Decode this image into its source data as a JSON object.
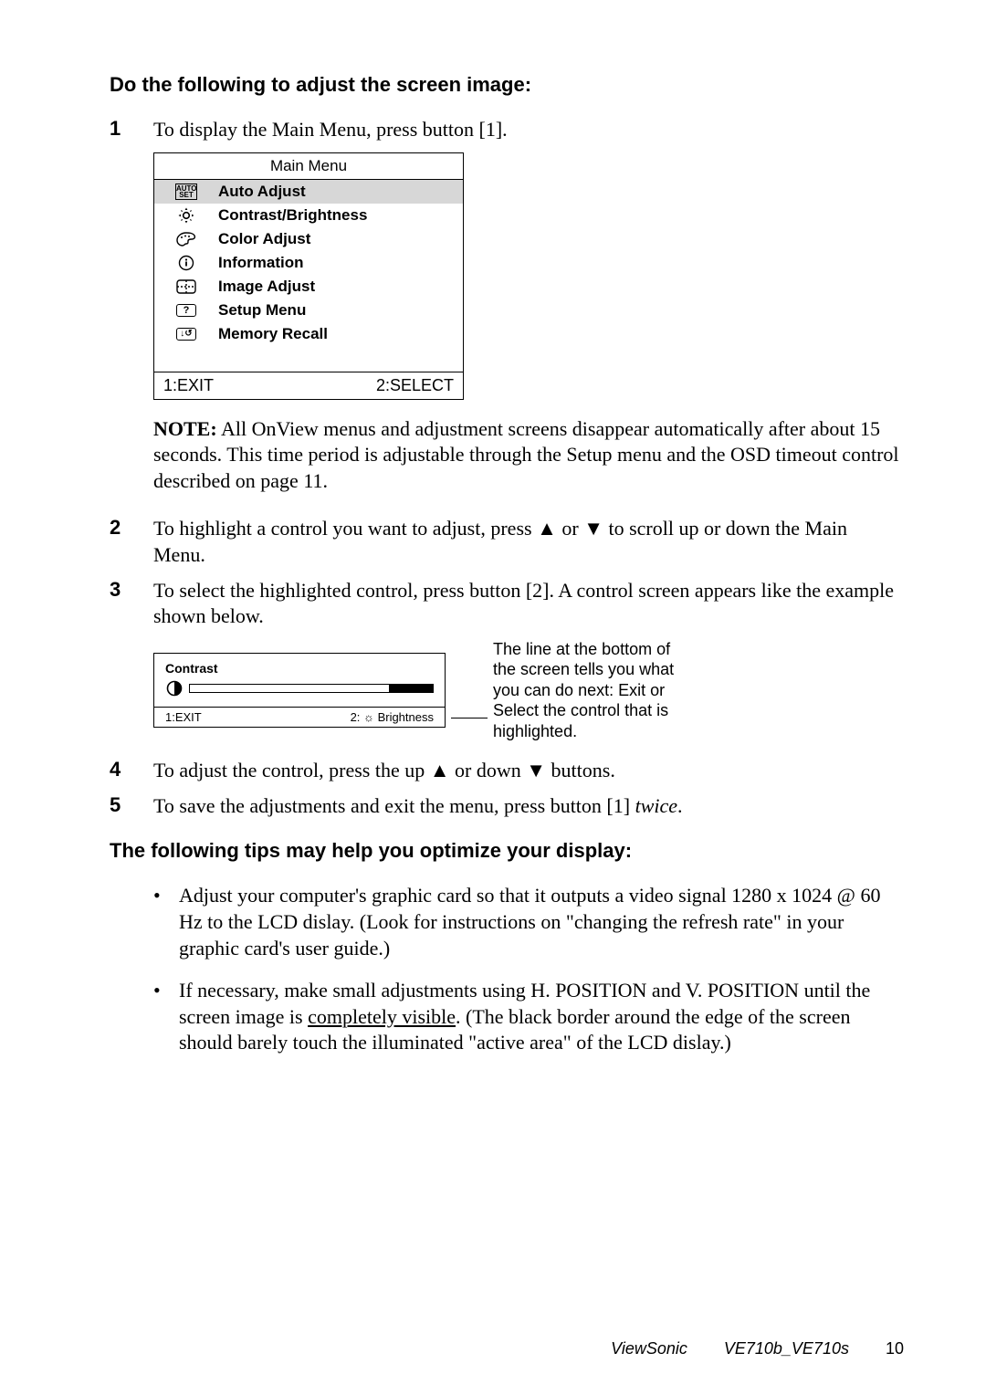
{
  "heading1": "Do the following to adjust the screen image:",
  "steps": {
    "s1": {
      "num": "1",
      "text": "To display the Main Menu, press button [1]."
    },
    "s2": {
      "num": "2",
      "text_a": "To highlight a control you want to adjust, press ",
      "up": "▲",
      "mid1": " or ",
      "down": "▼",
      "text_b": " to scroll up or down the Main Menu."
    },
    "s3": {
      "num": "3",
      "text": "To select the highlighted control, press button [2]. A control screen appears like the example shown below."
    },
    "s4": {
      "num": "4",
      "text_a": "To adjust the control, press the up ",
      "up": "▲",
      "mid1": " or down ",
      "down": "▼",
      "text_b": " buttons."
    },
    "s5": {
      "num": "5",
      "text_a": "To save the adjustments and exit the menu, press button [1] ",
      "twice": "twice",
      "text_b": "."
    }
  },
  "osd": {
    "title": "Main Menu",
    "autoset": {
      "l1": "AUTO",
      "l2": "SET"
    },
    "items": [
      "Auto Adjust",
      "Contrast/Brightness",
      "Color Adjust",
      "Information",
      "Image Adjust",
      "Setup Menu",
      "Memory Recall"
    ],
    "footer_left": "1:EXIT",
    "footer_right": "2:SELECT"
  },
  "note": {
    "label": "NOTE:",
    "text": " All OnView menus and adjustment screens disappear automatically after about 15 seconds. This time period is adjustable through the Setup menu and the OSD timeout control described on page 11."
  },
  "contrast": {
    "label": "Contrast",
    "footer_left": "1:EXIT",
    "footer_right_prefix": "2: ",
    "footer_right_icon": "☼",
    "footer_right_text": " Brightness"
  },
  "callout": "The line at the bottom of the screen tells you what you can do next: Exit or Select the control that is highlighted.",
  "heading2": "The following tips may help you optimize your display:",
  "bullets": {
    "b1": "Adjust your computer's graphic card so that it outputs a video signal 1280 x 1024 @ 60 Hz to the LCD dislay. (Look for instructions on \"changing the refresh rate\" in your graphic card's user guide.)",
    "b2_a": "If necessary, make small adjustments using H. POSITION and V. POSITION until the screen image is ",
    "b2_u": "completely visible",
    "b2_b": ". (The black border around the edge of the screen should barely touch the illuminated \"active area\" of the LCD dislay.)"
  },
  "footer": {
    "brand": "ViewSonic",
    "model": "VE710b_VE710s",
    "page": "10"
  },
  "icons": {
    "qmark": "?",
    "recall": "↓↺"
  }
}
